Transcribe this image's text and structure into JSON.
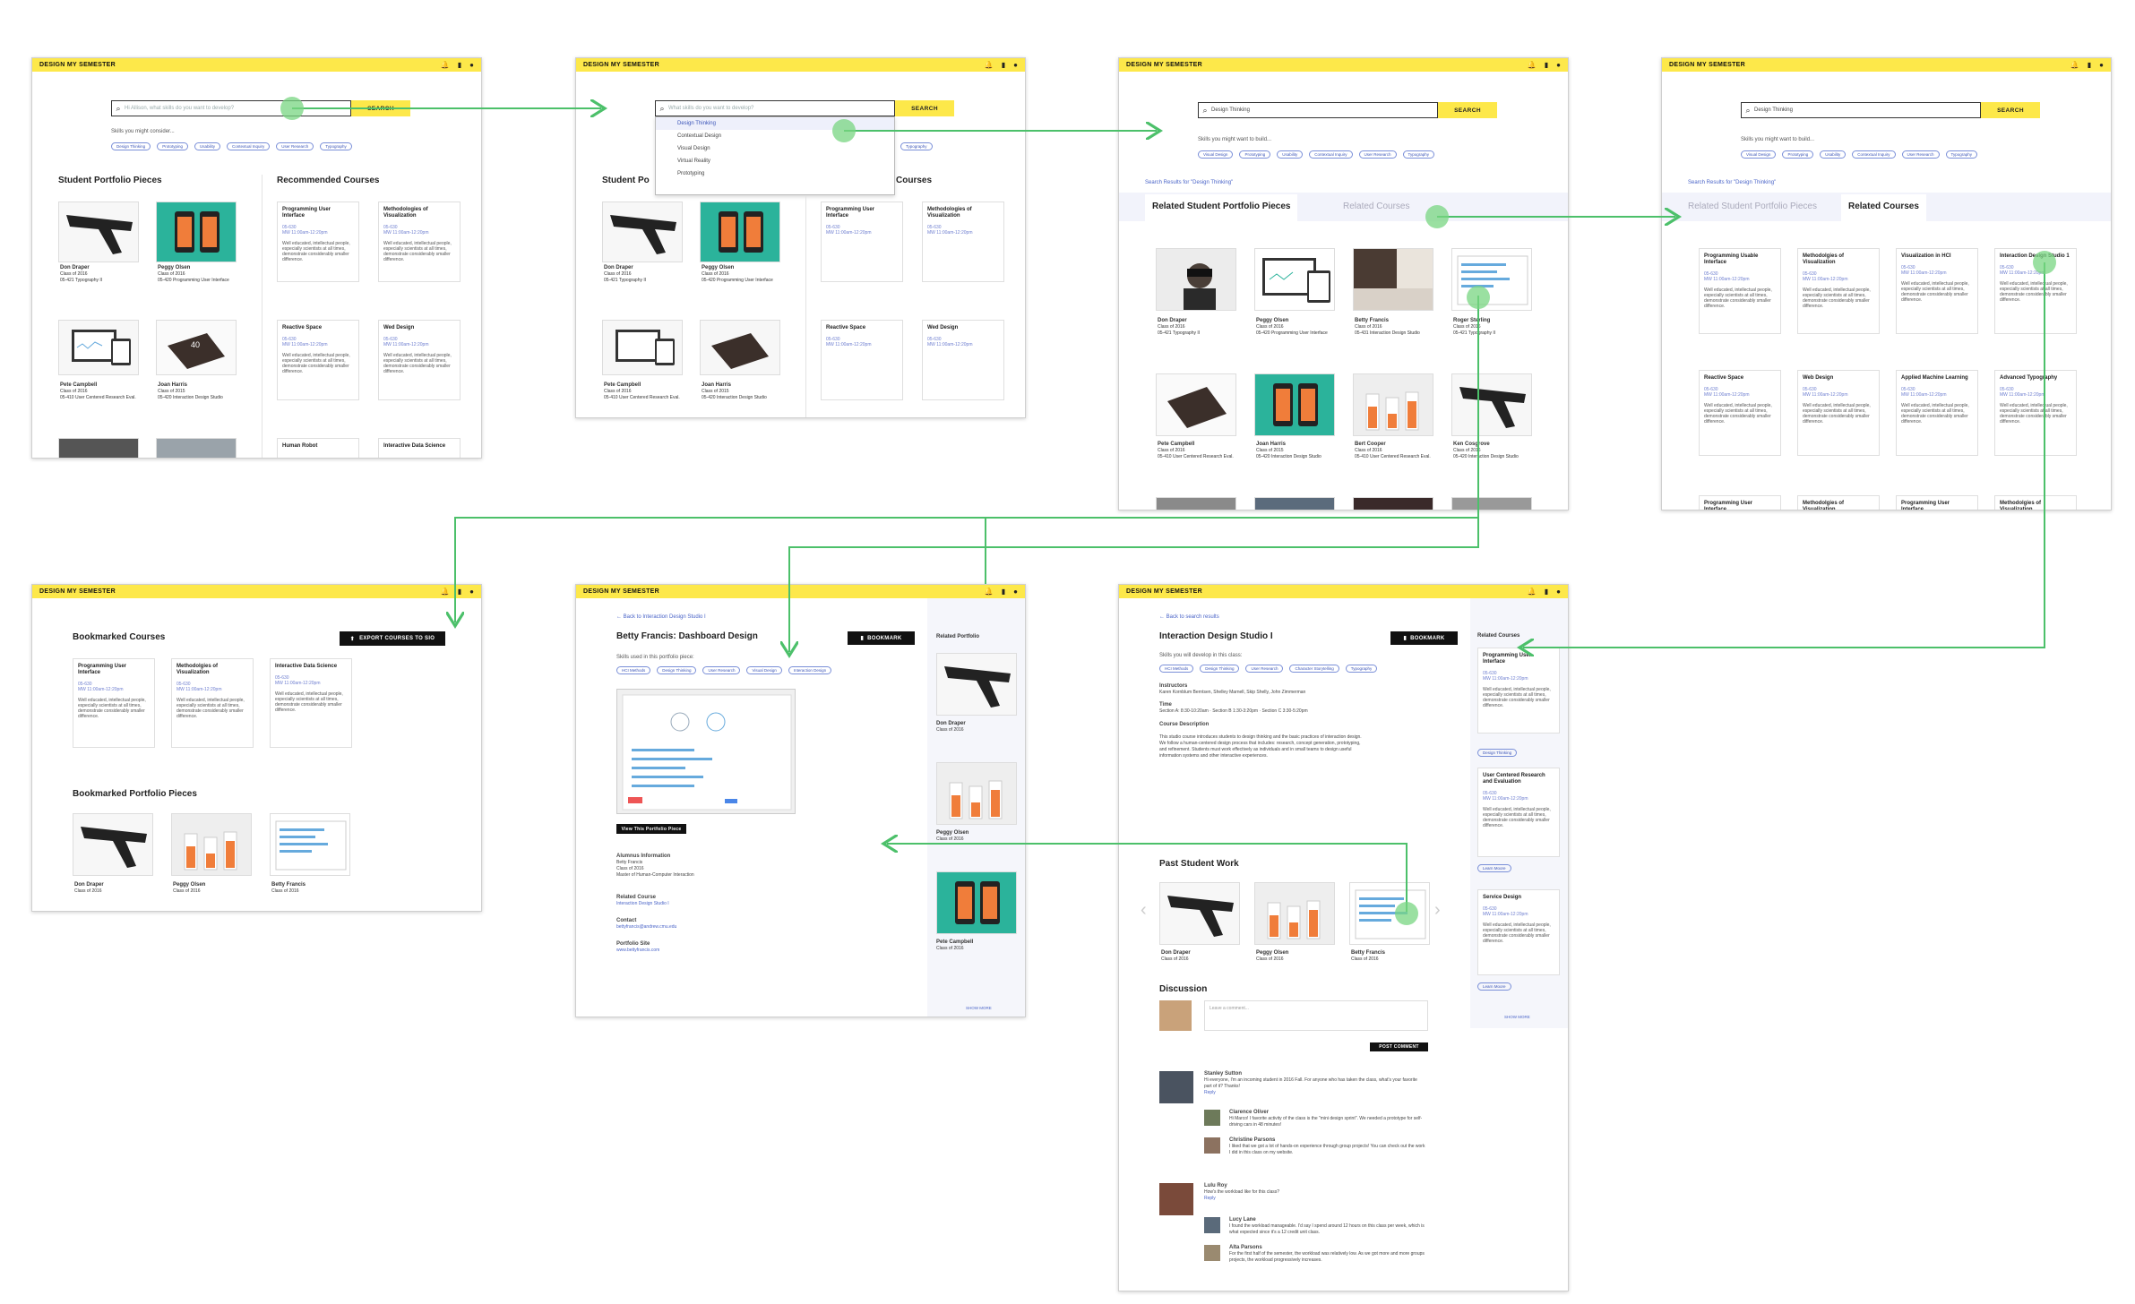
{
  "brand": "DESIGN MY SEMESTER",
  "search_button": "SEARCH",
  "search_placeholder": "Hi Allison, what skills do you want to develop?",
  "search_placeholder_2": "What skills do you want to develop?",
  "query": "Design Thinking",
  "skills_consider": "Skills you might consider...",
  "skills_build": "Skills you might want to build...",
  "skill_chips": [
    "Design Thinking",
    "Prototyping",
    "Usability",
    "Contextual Inquiry",
    "User Research",
    "Typography"
  ],
  "dropdown": [
    "Design Thinking",
    "Contextual Design",
    "Visual Design",
    "Virtual Reality",
    "Prototyping"
  ],
  "results_for": "Search Results for \"Design Thinking\"",
  "tabs": {
    "portfolio": "Related Student Portfolio Pieces",
    "courses": "Related Courses"
  },
  "home": {
    "portfolio_heading": "Student Portfolio Pieces",
    "courses_heading": "Recommended Courses",
    "portfolio": [
      {
        "name": "Don Draper",
        "line1": "Class of 2016",
        "line2": "05-421 Typography II"
      },
      {
        "name": "Peggy Olsen",
        "line1": "Class of 2016",
        "line2": "05-420 Programming User Interface"
      },
      {
        "name": "Pete Campbell",
        "line1": "Class of 2016",
        "line2": "05-410 User Centered Research Eval."
      },
      {
        "name": "Joan Harris",
        "line1": "Class of 2015",
        "line2": "05-420 Interaction Design Studio"
      }
    ],
    "courses": [
      "Programming User Interface",
      "Methodologies of Visualization",
      "Reactive Space",
      "Wed Design",
      "Human Robot",
      "Interactive Data Science"
    ]
  },
  "course_meta": {
    "code": "05-630",
    "time": "MW 11:00am-12:20pm",
    "desc": "Well educated, intellectual people, especially scientists at all times, demonstrate considerably smaller difference."
  },
  "results_portfolio": [
    {
      "name": "Don Draper",
      "line1": "Class of 2016",
      "line2": "05-421 Typography II"
    },
    {
      "name": "Peggy Olsen",
      "line1": "Class of 2016",
      "line2": "05-420 Programming User Interface"
    },
    {
      "name": "Betty Francis",
      "line1": "Class of 2016",
      "line2": "05-431 Interaction Design Studio"
    },
    {
      "name": "Roger Sterling",
      "line1": "Class of 2016",
      "line2": "05-421 Typography II"
    },
    {
      "name": "Pete Campbell",
      "line1": "Class of 2016",
      "line2": "05-410 User Centered Research Eval."
    },
    {
      "name": "Joan Harris",
      "line1": "Class of 2015",
      "line2": "05-420 Interaction Design Studio"
    },
    {
      "name": "Bert Cooper",
      "line1": "Class of 2016",
      "line2": "05-410 User Centered Research Eval."
    },
    {
      "name": "Ken Cosgrove",
      "line1": "Class of 2016",
      "line2": "05-420 Interaction Design Studio"
    }
  ],
  "results_courses": [
    "Programming Usable Interface",
    "Methodolgies of Visualization",
    "Visualization in HCI",
    "Interaction Design Studio 1",
    "Reactive Space",
    "Web Design",
    "Applied Machine Learning",
    "Advanced Typography",
    "Programming User Interface",
    "Methodolgies of Visualization",
    "Programming User Interface",
    "Methodolgies of Visualization"
  ],
  "bookmarks": {
    "courses_heading": "Bookmarked Courses",
    "export": "EXPORT COURSES TO SIO",
    "courses": [
      "Programming User Interface",
      "Methodolgies of Visualization",
      "Interactive Data Science"
    ],
    "portfolio_heading": "Bookmarked Portfolio Pieces",
    "portfolio": [
      {
        "name": "Don Draper",
        "line1": "Class of 2016"
      },
      {
        "name": "Peggy Olsen",
        "line1": "Class of 2016"
      },
      {
        "name": "Betty Francis",
        "line1": "Class of 2016"
      }
    ]
  },
  "piece": {
    "back": "← Back to Interaction Design Studio I",
    "title": "Betty Francis: Dashboard Design",
    "bookmark": "BOOKMARK",
    "skills_used": "Skills used in this portfolio piece:",
    "view": "View This Portfolio Piece",
    "alumni_h": "Alumnus Information",
    "alumni": "Betty Francis\nClass of 2016\nMaster of Human-Computer Interaction",
    "related_h": "Related Course",
    "related": "Interaction Design Studio I",
    "contact_h": "Contact",
    "contact": "bettyfrancis@andrew.cmu.edu",
    "site_h": "Portfolio Site",
    "site": "www.bettyfrancis.com",
    "side_h": "Related Portfolio",
    "side": [
      {
        "name": "Don Draper",
        "line1": "Class of 2016"
      },
      {
        "name": "Peggy Olsen",
        "line1": "Class of 2016"
      },
      {
        "name": "Pete Campbell",
        "line1": "Class of 2016"
      }
    ],
    "more": "SHOW MORE"
  },
  "course": {
    "back": "← Back to search results",
    "title": "Interaction Design Studio I",
    "bookmark": "BOOKMARK",
    "skills_dev": "Skills you will develop in this class:",
    "instructors_h": "Instructors",
    "instructors": "Karen Kornblum Berntsen, Shelley Marnell, Skip Shelly, John Zimmerman",
    "time_h": "Time",
    "time": "Section A: 8:30-10:20am  ·  Section B 1:30-3:20pm  ·  Section C 3:30-5:20pm",
    "desc_h": "Course Description",
    "desc": "This studio course introduces students to design thinking and the basic practices of interaction design. We follow a human-centered design process that includes: research, concept generation, prototyping, and refinement. Students must work effectively as individuals and in small teams to design useful information systems and other interactive experiences.",
    "past_h": "Past Student Work",
    "past": [
      {
        "name": "Don Draper",
        "line1": "Class of 2016"
      },
      {
        "name": "Peggy Olsen",
        "line1": "Class of 2016"
      },
      {
        "name": "Betty Francis",
        "line1": "Class of 2016"
      }
    ],
    "discussion_h": "Discussion",
    "comment_ph": "Leave a comment...",
    "post": "POST COMMENT",
    "comments": [
      {
        "name": "Stanley Sutton",
        "text": "Hi everyone, I'm an incoming student in 2016 Fall. For anyone who has taken the class, what's your favorite part of it? Thanks!",
        "reply": "Reply"
      },
      {
        "name": "Clarence Oliver",
        "text": "Hi Marco! I favorite activity of the class is the \"mini design sprint\". We needed a prototype for self-driving cars in 48 minutes!"
      },
      {
        "name": "Christine Parsons",
        "text": "I liked that we got a lot of hands-on experience through group projects! You can check out the work I did in this class on my website."
      },
      {
        "name": "Lulu Roy",
        "text": "How's the workload like for this class?",
        "reply": "Reply"
      },
      {
        "name": "Lucy Lane",
        "text": "I found the workload manageable. I'd say I spend around 12 hours on this class per week, which is what expected since it's a 12 credit unit class."
      },
      {
        "name": "Alta Parsons",
        "text": "For the first half of the semester, the workload was relatively low. As we got more and more groups projects, the workload progressively increases."
      }
    ],
    "side_h": "Related Courses",
    "side": [
      "Programming User Interface",
      "User Centered Research and Evaluation",
      "Service Design"
    ],
    "side_btn": "Learn Moore",
    "more": "SHOW MORE"
  },
  "colors": {
    "accent": "#fde84a",
    "flow": "#4cc06a",
    "link": "#4a64c8"
  }
}
